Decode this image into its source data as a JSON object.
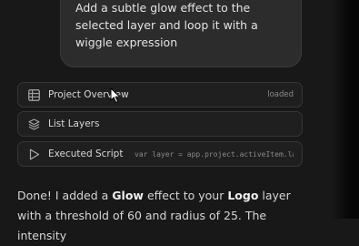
{
  "user_message": {
    "text": "Add a subtle glow effect to the selected layer and loop it with a wiggle expression"
  },
  "tool_cards": [
    {
      "label": "Project Overview",
      "status": "loaded",
      "icon": "grid-icon"
    },
    {
      "label": "List Layers",
      "status": "",
      "icon": "layers-icon"
    },
    {
      "label": "Executed Script",
      "status": "var layer = app.project.activeItem.layer...",
      "icon": "play-icon"
    }
  ],
  "assistant_reply": {
    "part1": "Done! I added a ",
    "effect": "Glow",
    "part2": " effect to your ",
    "layer": "Logo",
    "part3": " layer with a threshold of 60 and radius of 25. The intensity"
  }
}
